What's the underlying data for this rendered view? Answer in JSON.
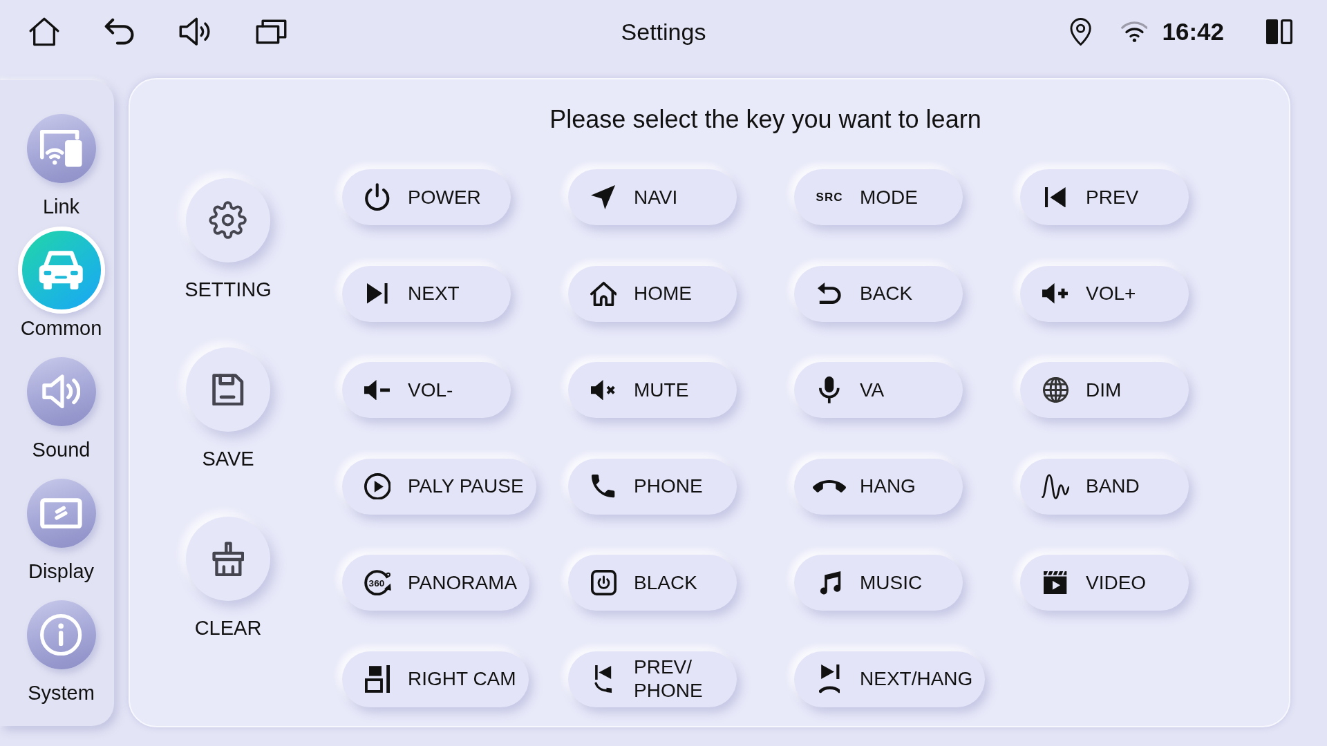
{
  "top_bar": {
    "title": "Settings",
    "time": "16:42"
  },
  "sidebar": {
    "items": [
      {
        "label": "Link",
        "selected": false
      },
      {
        "label": "Common",
        "selected": true
      },
      {
        "label": "Sound",
        "selected": false
      },
      {
        "label": "Display",
        "selected": false
      },
      {
        "label": "System",
        "selected": false
      }
    ]
  },
  "learn_panel": {
    "heading": "Please select the key you want to learn",
    "actions": [
      {
        "label": "SETTING"
      },
      {
        "label": "SAVE"
      },
      {
        "label": "CLEAR"
      }
    ],
    "keys": [
      {
        "label": "POWER"
      },
      {
        "label": "NAVI"
      },
      {
        "label": "MODE",
        "icon_text": "SRC"
      },
      {
        "label": "PREV"
      },
      {
        "label": "NEXT"
      },
      {
        "label": "HOME"
      },
      {
        "label": "BACK"
      },
      {
        "label": "VOL+"
      },
      {
        "label": "VOL-"
      },
      {
        "label": "MUTE"
      },
      {
        "label": "VA"
      },
      {
        "label": "DIM"
      },
      {
        "label": "PALY PAUSE"
      },
      {
        "label": "PHONE"
      },
      {
        "label": "HANG"
      },
      {
        "label": "BAND"
      },
      {
        "label": "PANORAMA",
        "icon_text": "360"
      },
      {
        "label": "BLACK"
      },
      {
        "label": "MUSIC"
      },
      {
        "label": "VIDEO"
      },
      {
        "label": "RIGHT CAM"
      },
      {
        "label": "PREV/\nPHONE"
      },
      {
        "label": "NEXT/HANG"
      }
    ]
  }
}
